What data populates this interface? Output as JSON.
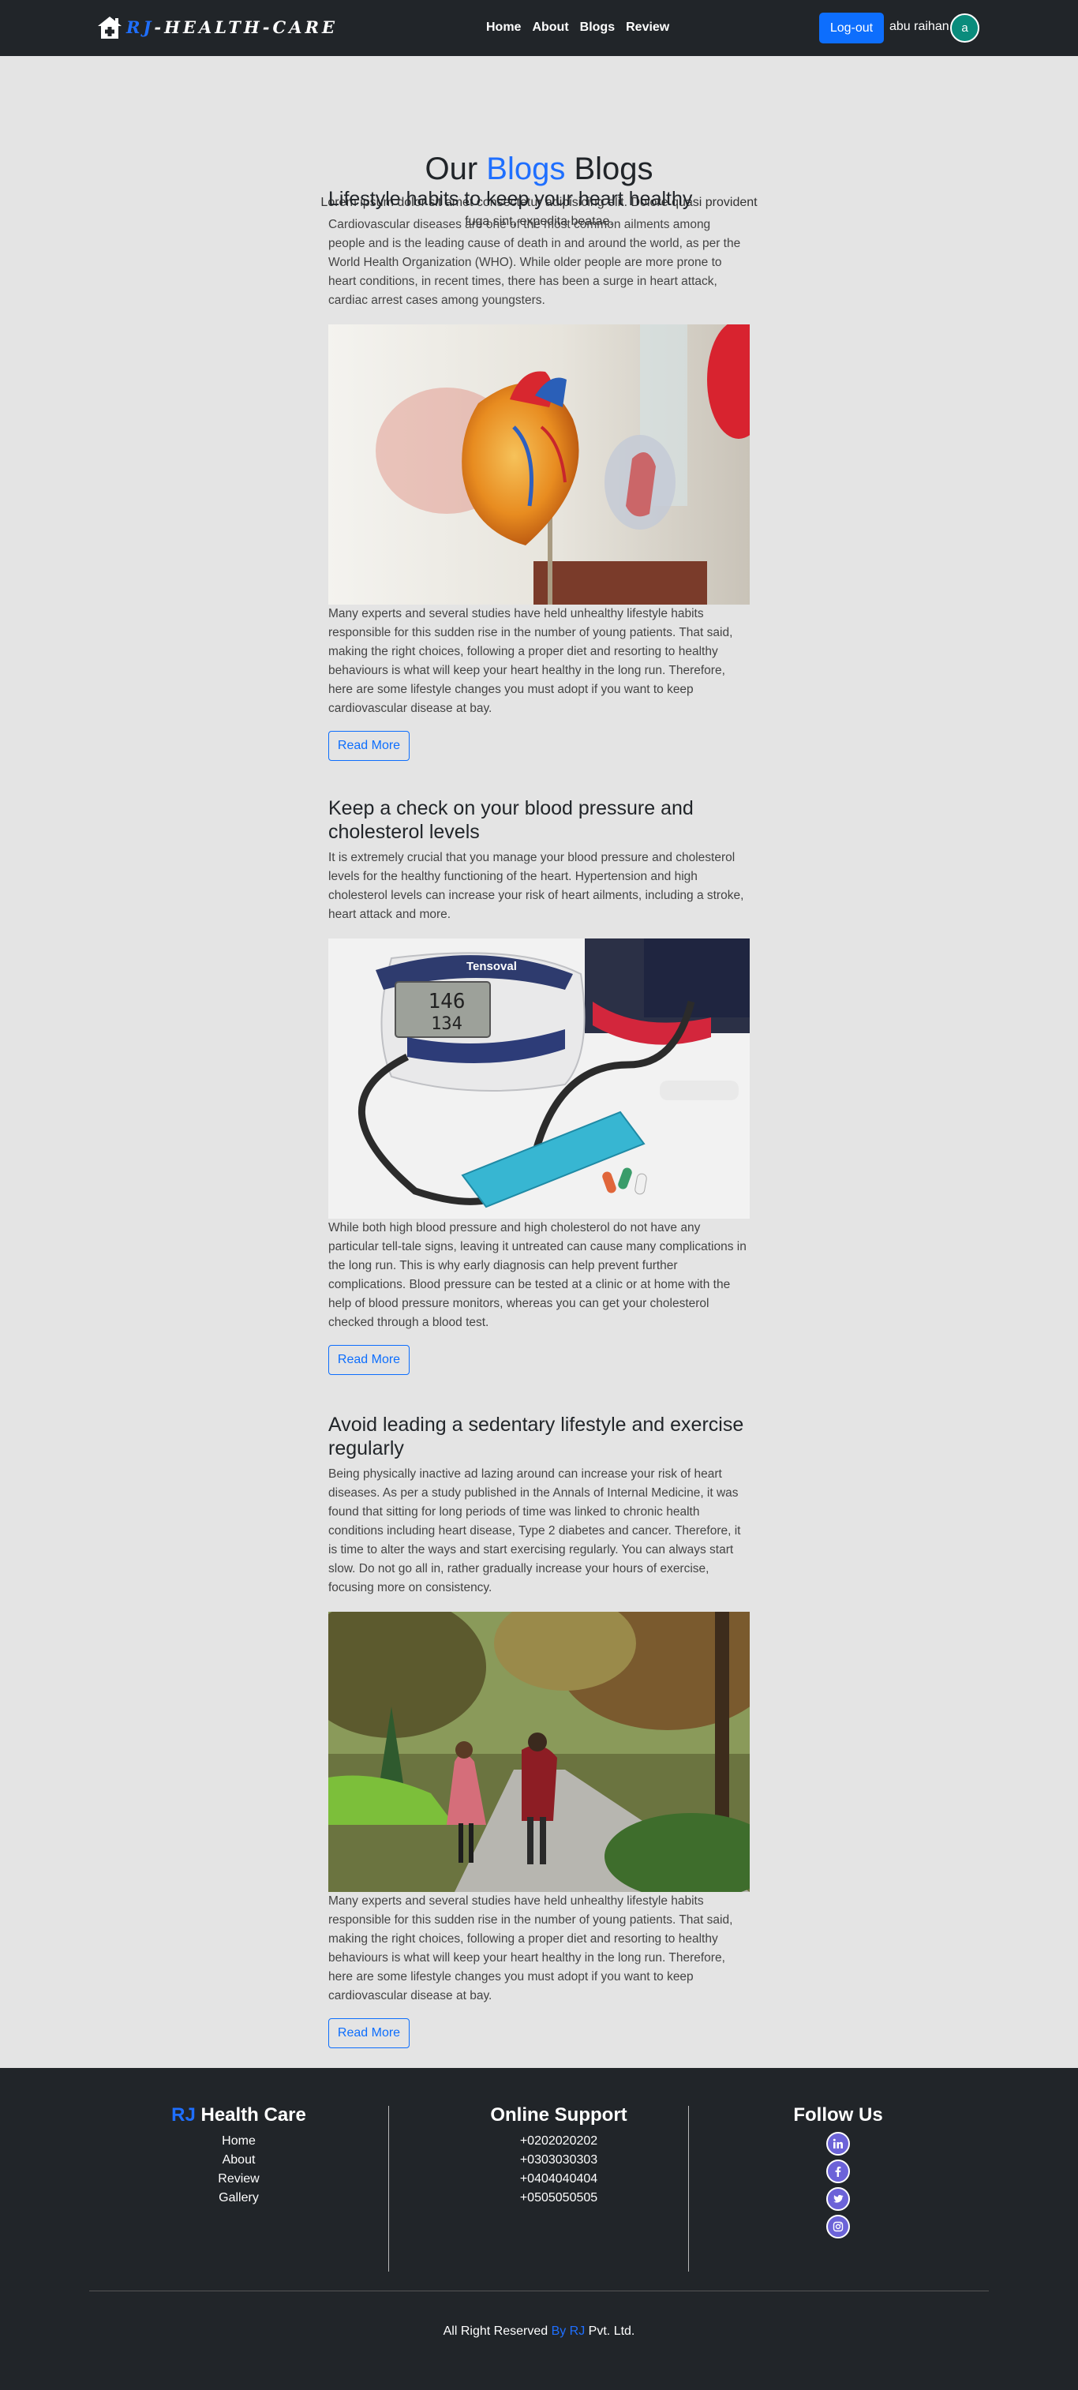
{
  "brand": {
    "prefix": "RJ",
    "rest": "-HEALTH-CARE",
    "icon": "house-medical-icon"
  },
  "nav": {
    "items": [
      "Home",
      "About",
      "Blogs",
      "Review"
    ]
  },
  "user": {
    "logout_label": "Log-out",
    "name": "abu raihan",
    "avatar_letter": "a"
  },
  "page": {
    "title_prefix": "Our ",
    "title_accent": "Blogs",
    "title_suffix": " Blogs",
    "subtitle": "Lorem ipsum dolor sit amet consectetur adipisicing elit. Dolore quasi provident fuga sint, expedita beatae."
  },
  "blogs": [
    {
      "title": "Lifestyle habits to keep your heart healthy",
      "intro": "Cardiovascular diseases are one of the most common ailments among people and is the leading cause of death in and around the world, as per the World Health Organization (WHO). While older people are more prone to heart conditions, in recent times, there has been a surge in heart attack, cardiac arrest cases among youngsters.",
      "body": "Many experts and several studies have held unhealthy lifestyle habits responsible for this sudden rise in the number of young patients. That said, making the right choices, following a proper diet and resorting to healthy behaviours is what will keep your heart healthy in the long run. Therefore, here are some lifestyle changes you must adopt if you want to keep cardiovascular disease at bay.",
      "button": "Read More"
    },
    {
      "title": "Keep a check on your blood pressure and cholesterol levels",
      "intro": "It is extremely crucial that you manage your blood pressure and cholesterol levels for the healthy functioning of the heart. Hypertension and high cholesterol levels can increase your risk of heart ailments, including a stroke, heart attack and more.",
      "body": "While both high blood pressure and high cholesterol do not have any particular tell-tale signs, leaving it untreated can cause many complications in the long run. This is why early diagnosis can help prevent further complications. Blood pressure can be tested at a clinic or at home with the help of blood pressure monitors, whereas you can get your cholesterol checked through a blood test.",
      "button": "Read More",
      "image_text": {
        "brand": "Tensoval",
        "reading1": "146",
        "reading2": "134"
      }
    },
    {
      "title": "Avoid leading a sedentary lifestyle and exercise regularly",
      "intro": "Being physically inactive ad lazing around can increase your risk of heart diseases. As per a study published in the Annals of Internal Medicine, it was found that sitting for long periods of time was linked to chronic health conditions including heart disease, Type 2 diabetes and cancer. Therefore, it is time to alter the ways and start exercising regularly. You can always start slow. Do not go all in, rather gradually increase your hours of exercise, focusing more on consistency.",
      "body": "Many experts and several studies have held unhealthy lifestyle habits responsible for this sudden rise in the number of young patients. That said, making the right choices, following a proper diet and resorting to healthy behaviours is what will keep your heart healthy in the long run. Therefore, here are some lifestyle changes you must adopt if you want to keep cardiovascular disease at bay.",
      "button": "Read More"
    }
  ],
  "footer": {
    "brand_prefix": "RJ",
    "brand_rest": " Health Care",
    "links": [
      "Home",
      "About",
      "Review",
      "Gallery"
    ],
    "support_title": "Online Support",
    "phones": [
      "+0202020202",
      "+0303030303",
      "+0404040404",
      "+0505050505"
    ],
    "follow_title": "Follow Us",
    "social_icons": [
      "linkedin-icon",
      "facebook-icon",
      "twitter-icon",
      "instagram-icon"
    ],
    "copyright_prefix": "All Right Reserved ",
    "copyright_accent": "By RJ",
    "copyright_suffix": " Pvt. Ltd."
  },
  "colors": {
    "accent": "#1f6fff",
    "button": "#0d6efd",
    "dark": "#212529",
    "background": "#e4e4e4"
  }
}
